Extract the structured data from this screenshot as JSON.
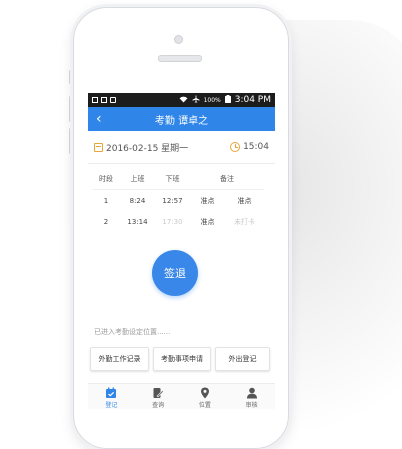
{
  "statusbar": {
    "battery_text": "100%",
    "time": "3:04 PM"
  },
  "header": {
    "title": "考勤  谭卓之"
  },
  "datebar": {
    "date": "2016-02-15 星期一",
    "time": "15:04"
  },
  "table": {
    "columns": [
      "时段",
      "上班",
      "下班",
      "备注"
    ],
    "rows": [
      {
        "slot": "1",
        "on": "8:24",
        "off": "12:57",
        "note_on": "准点",
        "note_off": "准点"
      },
      {
        "slot": "2",
        "on": "13:14",
        "off": "17:30",
        "note_on": "准点",
        "note_off": "未打卡"
      }
    ]
  },
  "signout_label": "签退",
  "location_text": "已进入考勤设定位置......",
  "actions": [
    "外勤工作记录",
    "考勤事项申请",
    "外出登记"
  ],
  "tabs": [
    "登记",
    "查询",
    "位置",
    "审核"
  ],
  "colors": {
    "accent": "#2f86e8",
    "date_icon": "#e5a73a",
    "statusbar": "#1c1c1c"
  }
}
